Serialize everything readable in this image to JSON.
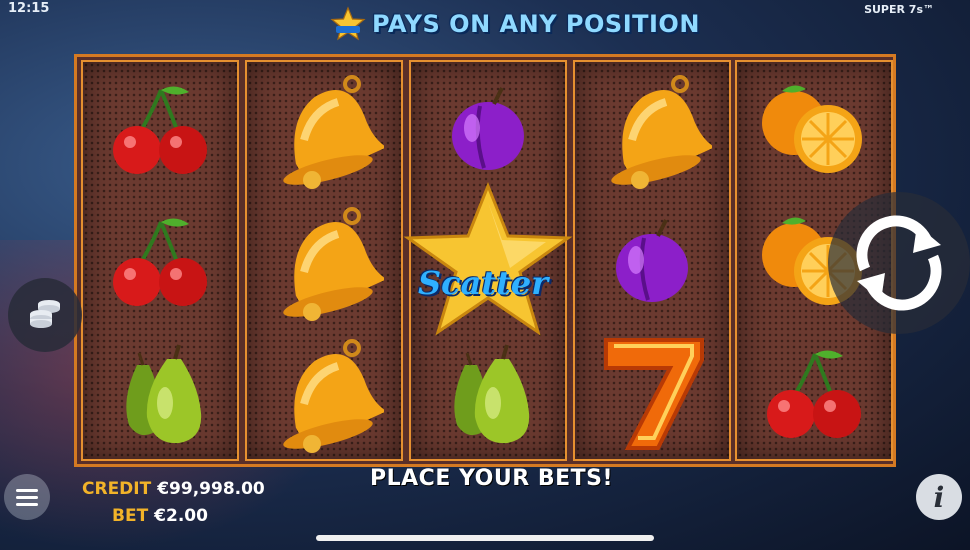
{
  "status_bar": {
    "time": "12:15",
    "game_name": "SUPER 7s™"
  },
  "header": {
    "title": "PAYS ON ANY POSITION",
    "title_icon": "scatter-star-icon",
    "title_color": "#8fd9ff"
  },
  "reels": [
    {
      "symbols": [
        "cherry",
        "cherry",
        "pear"
      ]
    },
    {
      "symbols": [
        "bell",
        "bell",
        "bell"
      ]
    },
    {
      "symbols": [
        "plum",
        "scatter",
        "pear"
      ]
    },
    {
      "symbols": [
        "bell",
        "plum",
        "seven"
      ]
    },
    {
      "symbols": [
        "orange",
        "orange",
        "cherry"
      ]
    }
  ],
  "scatter_label": "Scatter",
  "controls": {
    "left_button_icon": "coin-stack-icon",
    "spin_button_icon": "spin-arrows-icon",
    "menu_icon": "hamburger-menu-icon",
    "info_label": "i"
  },
  "footer": {
    "credit_label": "CREDIT",
    "credit_value": "€99,998.00",
    "bet_label": "BET",
    "bet_value": "€2.00",
    "status_message": "PLACE YOUR BETS!"
  },
  "colors": {
    "frame": "#d57a22",
    "label": "#f2b329",
    "reel_bg": "#6b3a30"
  }
}
